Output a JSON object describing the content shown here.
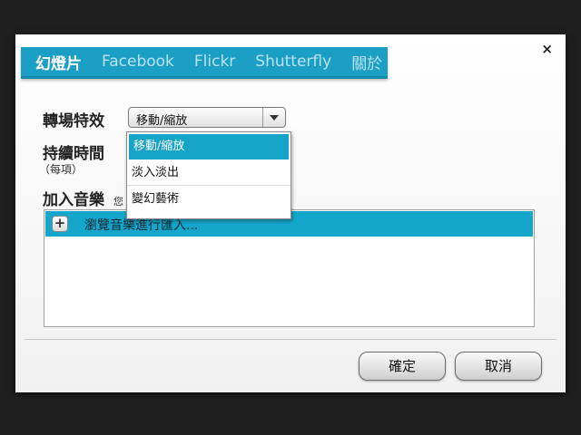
{
  "tabs": [
    {
      "label": "幻燈片"
    },
    {
      "label": "Facebook"
    },
    {
      "label": "Flickr"
    },
    {
      "label": "Shutterfly"
    },
    {
      "label": "關於"
    }
  ],
  "close_label": "×",
  "transition": {
    "label": "轉場特效",
    "selected": "移動/縮放",
    "options": [
      "移動/縮放",
      "淡入淡出",
      "變幻藝術"
    ]
  },
  "duration": {
    "label": "持續時間",
    "sublabel": "（每項）"
  },
  "music": {
    "label": "加入音樂",
    "hint": "您",
    "browse_label": "瀏覽音樂進行匯入..."
  },
  "buttons": {
    "ok": "確定",
    "cancel": "取消"
  }
}
